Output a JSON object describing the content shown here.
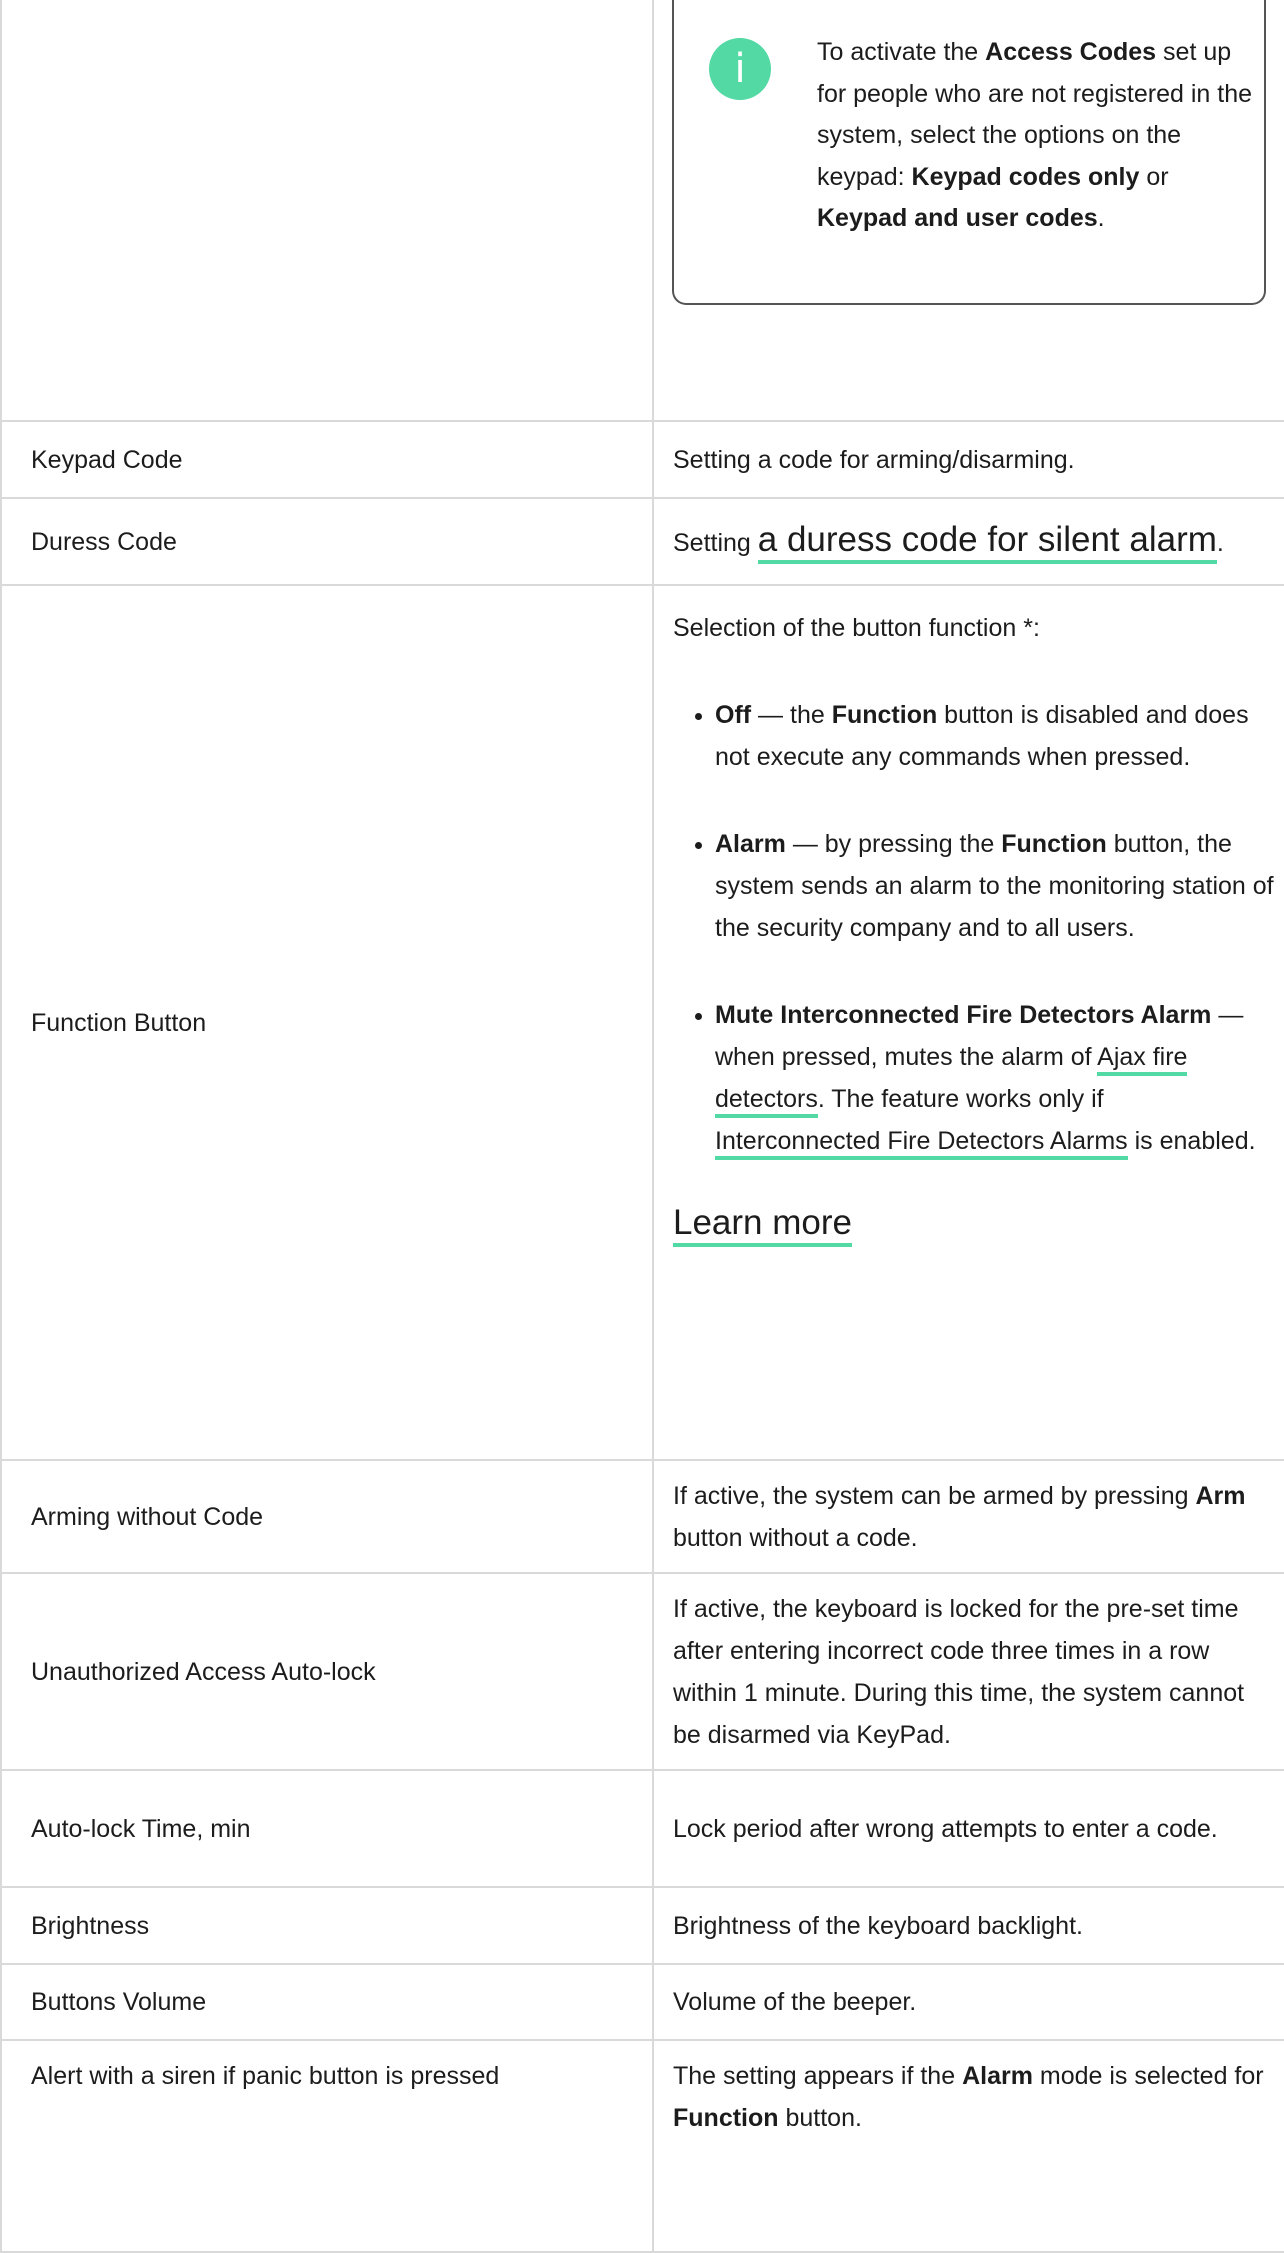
{
  "callout": {
    "icon": "info-icon",
    "glyph": "i",
    "text_parts": [
      "To activate the ",
      "Access Codes",
      " set up for people who are not registered in the system, select the options on the keypad: ",
      "Keypad codes only",
      " or ",
      "Keypad and user codes",
      "."
    ]
  },
  "rows": [
    {
      "name": "Keypad Code",
      "desc": "Setting a code for arming/disarming."
    },
    {
      "name": "Duress Code",
      "desc_prefix": "Setting ",
      "desc_link": "a duress code for silent alarm",
      "desc_suffix": "."
    },
    {
      "name": "Function Button",
      "intro": "Selection of the button function *:",
      "items": [
        {
          "term": "Off",
          "parts": [
            " — the ",
            "Function",
            " button is disabled and does not execute any commands when pressed."
          ]
        },
        {
          "term": "Alarm",
          "parts": [
            " — by pressing the ",
            "Function",
            " button, the system sends an alarm to the monitoring station of the security company and to all users."
          ]
        },
        {
          "term": "Mute Interconnected Fire Detectors Alarm",
          "parts": [
            " — when pressed, mutes the alarm of ",
            "Ajax fire detectors",
            ". The feature works only if ",
            "Interconnected Fire Detectors Alarms",
            " is enabled."
          ]
        }
      ],
      "learn_more": "Learn more"
    },
    {
      "name": "Arming without Code",
      "desc_parts": [
        "If active, the system can be armed by pressing ",
        "Arm",
        " button without a code."
      ]
    },
    {
      "name": "Unauthorized Access Auto-lock",
      "desc": "If active, the keyboard is locked for the pre-set time after entering incorrect code three times in a row within 1 minute. During this time, the system cannot be disarmed via KeyPad."
    },
    {
      "name": "Auto-lock Time, min",
      "desc": "Lock period after wrong attempts to enter a code."
    },
    {
      "name": "Brightness",
      "desc": "Brightness of the keyboard backlight."
    },
    {
      "name": "Buttons Volume",
      "desc": "Volume of the beeper."
    },
    {
      "name": "Alert with a siren if panic button is pressed",
      "desc_parts": [
        "The setting appears if the ",
        "Alarm",
        " mode is selected for ",
        "Function",
        " button."
      ]
    }
  ],
  "colors": {
    "accent": "#52d9a4",
    "border": "#d9d9d9"
  }
}
